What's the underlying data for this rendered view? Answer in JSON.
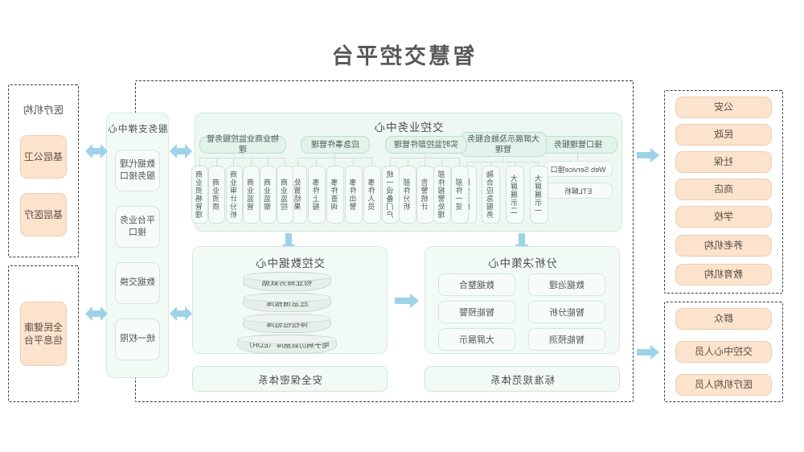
{
  "title": "智慧交控平台",
  "colors": {
    "accent_orange": "#fbe3cd",
    "accent_green": "#e2f3ea",
    "panel_bg": "#eef8f3",
    "arrow": "#9ed2e8",
    "dash_border": "#3b3b3b"
  },
  "left_actors_group": {
    "items": [
      {
        "label": "公安"
      },
      {
        "label": "民政"
      },
      {
        "label": "社保"
      },
      {
        "label": "商店"
      },
      {
        "label": "学校"
      },
      {
        "label": "养老机构"
      },
      {
        "label": "教育机构"
      }
    ]
  },
  "left_users_group": {
    "items": [
      {
        "label": "群众"
      },
      {
        "label": "交控中心人员"
      },
      {
        "label": "医疗机构人员"
      }
    ]
  },
  "main": {
    "business_center": {
      "title": "交控业务中心",
      "groups": [
        {
          "header": "接口管理服务",
          "style": "plain",
          "items": [
            "Web Service接口",
            "ETL解析"
          ]
        },
        {
          "header": "大屏展示及融合服务管理",
          "style": "vertical",
          "items": [
            "大屏展示一",
            "大屏展示二",
            "融合应急服务",
            "服务调度"
          ]
        },
        {
          "header": "实时监控部件管理",
          "style": "vertical",
          "items": [
            "部件一览",
            "部件报警处理",
            "告警统计",
            "部件分析",
            "统一设备门户"
          ]
        },
        {
          "header": "应急事件管理",
          "style": "vertical",
          "items": [
            "事件人员",
            "事件出警",
            "事件查询",
            "事件上报",
            "处置结果"
          ]
        },
        {
          "header": "物业商业监控服务管理",
          "style": "vertical",
          "items": [
            "商业监控",
            "商业监察",
            "商业监管",
            "商业审计分析",
            "商业资质",
            "商业资格管理"
          ]
        }
      ]
    },
    "analysis_center": {
      "title": "分析决策中心",
      "items": [
        "数据治理",
        "数据整合",
        "智能分析",
        "智能预警",
        "智能预测",
        "大屏展示"
      ]
    },
    "data_center": {
      "title": "交控数据中心",
      "databases": [
        "物业商务数据",
        "应急情报库",
        "体检检验库",
        "电子病历数据库（EDR）"
      ]
    },
    "bottom_bars": [
      {
        "label": "标准规范体系"
      },
      {
        "label": "安全保密体系"
      }
    ]
  },
  "support_center": {
    "title": "服务支撑中心",
    "items": [
      "数据代理服务接口",
      "平台业务接口",
      "数据交换",
      "统一权限"
    ]
  },
  "right_medical_group": {
    "title": "医疗机构",
    "items": [
      {
        "label": "基层公卫"
      },
      {
        "label": "基层医疗"
      }
    ]
  },
  "right_platform_group": {
    "items": [
      {
        "label": "全民健康信息平台"
      }
    ]
  },
  "arrows": {
    "left_actors_arrow": "left-right-arrow",
    "left_users_arrow": "left-right-arrow",
    "business_to_analysis": "down-arrow",
    "business_to_data": "down-arrow",
    "data_to_analysis": "left-arrow",
    "business_to_support": "left-right-arrow",
    "data_to_support": "left-right-arrow",
    "support_to_medical": "left-right-arrow",
    "support_to_platform": "left-right-arrow"
  }
}
